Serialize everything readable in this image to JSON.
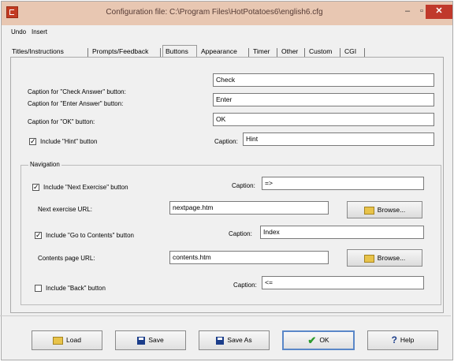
{
  "window": {
    "title": "Configuration file: C:\\Program Files\\HotPotatoes6\\english6.cfg",
    "min": "–",
    "max": "▫",
    "close": "✕"
  },
  "menu": {
    "undo": "Undo",
    "insert": "Insert"
  },
  "tabs": [
    {
      "label": "Titles/Instructions"
    },
    {
      "label": "Prompts/Feedback"
    },
    {
      "label": "Buttons"
    },
    {
      "label": "Appearance"
    },
    {
      "label": "Timer"
    },
    {
      "label": "Other"
    },
    {
      "label": "Custom"
    },
    {
      "label": "CGI"
    }
  ],
  "captions": {
    "check_label": "Caption for \"Check Answer\" button:",
    "check_value": "Check",
    "enter_label": "Caption for \"Enter Answer\" button:",
    "enter_value": "Enter",
    "ok_label": "Caption for \"OK\" button:",
    "ok_value": "OK",
    "hint_checkbox_label": "Include \"Hint\" button",
    "hint_caption_label": "Caption:",
    "hint_value": "Hint"
  },
  "navigation": {
    "title": "Navigation",
    "next_checkbox_label": "Include \"Next Exercise\" button",
    "next_caption_label": "Caption:",
    "next_caption_value": "=>",
    "next_url_label": "Next exercise URL:",
    "next_url_value": "nextpage.htm",
    "browse_label": "Browse...",
    "contents_checkbox_label": "Include \"Go to Contents\" button",
    "contents_caption_label": "Caption:",
    "contents_caption_value": "Index",
    "contents_url_label": "Contents page URL:",
    "contents_url_value": "contents.htm",
    "browse2_label": "Browse...",
    "back_checkbox_label": "Include \"Back\" button",
    "back_caption_label": "Caption:",
    "back_caption_value": "<="
  },
  "bottom": {
    "load": "Load",
    "save": "Save",
    "save_as": "Save As",
    "ok": "OK",
    "help": "Help"
  }
}
